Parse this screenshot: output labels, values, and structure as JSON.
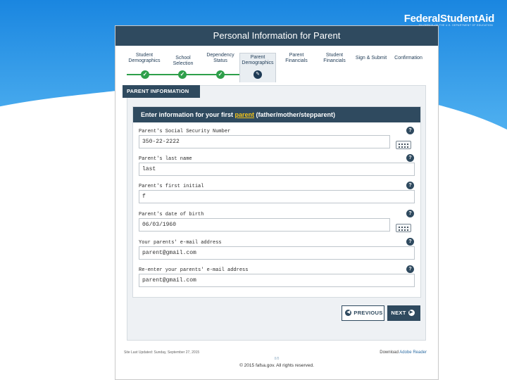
{
  "brand": {
    "name_part1": "Federal",
    "name_part2": "StudentAid",
    "tagline": "AN OFFICE OF THE U.S. DEPARTMENT OF EDUCATION"
  },
  "window": {
    "title": "Personal Information for Parent"
  },
  "steps": [
    {
      "label_line1": "Student",
      "label_line2": "Demographics",
      "status": "complete"
    },
    {
      "label_line1": "School Selection",
      "label_line2": "",
      "status": "complete"
    },
    {
      "label_line1": "Dependency",
      "label_line2": "Status",
      "status": "complete"
    },
    {
      "label_line1": "Parent",
      "label_line2": "Demographics",
      "status": "current"
    },
    {
      "label_line1": "Parent",
      "label_line2": "Financials",
      "status": "pending"
    },
    {
      "label_line1": "Student",
      "label_line2": "Financials",
      "status": "pending"
    },
    {
      "label_line1": "Sign & Submit",
      "label_line2": "",
      "status": "pending"
    },
    {
      "label_line1": "Confirmation",
      "label_line2": "",
      "status": "pending"
    }
  ],
  "section": {
    "tab_label": "PARENT INFORMATION"
  },
  "form": {
    "heading_before": "Enter information for your first ",
    "heading_highlight": "parent",
    "heading_after": " (father/mother/stepparent)",
    "fields": [
      {
        "label": "Parent's Social Security Number",
        "value": "350-22-2222"
      },
      {
        "label": "Parent's last name",
        "value": "last"
      },
      {
        "label": "Parent's first initial",
        "value": "f"
      },
      {
        "label": "Parent's date of birth",
        "value": "06/03/1960"
      },
      {
        "label": "Your parents' e-mail address",
        "value": "parent@gmail.com"
      },
      {
        "label": "Re-enter your parents' e-mail address",
        "value": "parent@gmail.com"
      }
    ],
    "help_glyph": "?"
  },
  "buttons": {
    "previous": "PREVIOUS",
    "next": "NEXT"
  },
  "footer": {
    "last_updated": "Site Last Updated: Sunday, September 27, 2015",
    "download_prefix": "Download ",
    "download_link": "Adobe Reader",
    "page_marker": "8/8",
    "copyright": "© 2015 fafsa.gov. All rights reserved."
  },
  "colors": {
    "header_navy": "#2f4a5f",
    "progress_green": "#2e9f4a",
    "sky_blue": "#1e8ee6",
    "highlight_yellow": "#f5c518"
  },
  "icons": [
    "check-icon",
    "pencil-icon",
    "help-icon",
    "keyboard-icon",
    "arrow-left-icon",
    "arrow-right-icon"
  ]
}
